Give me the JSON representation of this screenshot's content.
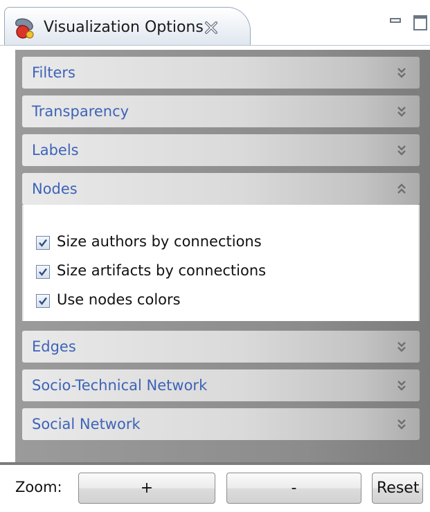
{
  "window": {
    "tab_title": "Visualization Options",
    "tab_icon": "visualization-icon",
    "close_icon": "close-icon",
    "minimize_icon": "minimize-icon",
    "maximize_icon": "maximize-icon"
  },
  "sections": [
    {
      "label": "Filters",
      "expanded": false,
      "icon": "chevron-double-down-icon"
    },
    {
      "label": "Transparency",
      "expanded": false,
      "icon": "chevron-double-down-icon"
    },
    {
      "label": "Labels",
      "expanded": false,
      "icon": "chevron-double-down-icon"
    },
    {
      "label": "Nodes",
      "expanded": true,
      "icon": "chevron-double-up-icon"
    },
    {
      "label": "Edges",
      "expanded": false,
      "icon": "chevron-double-down-icon"
    },
    {
      "label": "Socio-Technical Network",
      "expanded": false,
      "icon": "chevron-double-down-icon"
    },
    {
      "label": "Social Network",
      "expanded": false,
      "icon": "chevron-double-down-icon"
    }
  ],
  "nodes_options": [
    {
      "label": "Size authors by connections",
      "checked": true
    },
    {
      "label": "Size artifacts by connections",
      "checked": true
    },
    {
      "label": "Use nodes colors",
      "checked": true
    }
  ],
  "zoom": {
    "label": "Zoom:",
    "zoom_in": "+",
    "zoom_out": "-",
    "reset": "Reset"
  },
  "colors": {
    "section_title": "#3d63b8",
    "panel_background": "#8c8c8c"
  }
}
